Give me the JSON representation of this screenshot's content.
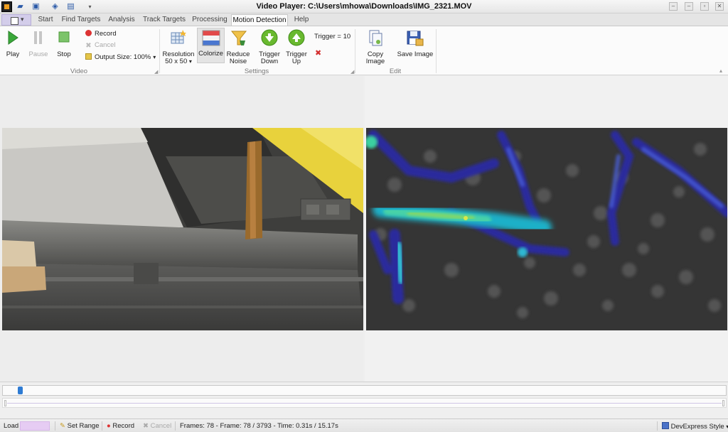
{
  "window": {
    "title": "Video Player: C:\\Users\\mhowa\\Downloads\\IMG_2321.MOV",
    "controls": [
      "–",
      "▫",
      "✕"
    ]
  },
  "tabs": [
    {
      "label": "Start"
    },
    {
      "label": "Find Targets"
    },
    {
      "label": "Analysis"
    },
    {
      "label": "Track Targets"
    },
    {
      "label": "Processing"
    },
    {
      "label": "Motion Detection",
      "active": true
    },
    {
      "label": "Help"
    }
  ],
  "ribbon": {
    "video": {
      "label": "Video",
      "play": "Play",
      "pause": "Pause",
      "stop": "Stop",
      "record": "Record",
      "cancel": "Cancel",
      "output_size": "Output Size: 100%"
    },
    "settings": {
      "label": "Settings",
      "resolution_line1": "Resolution",
      "resolution_line2": "50 x 50",
      "colorize": "Colorize",
      "reduce_noise_line1": "Reduce",
      "reduce_noise_line2": "Noise",
      "trigger_down_line1": "Trigger",
      "trigger_down_line2": "Down",
      "trigger_up_line1": "Trigger",
      "trigger_up_line2": "Up",
      "trigger_value": "Trigger = 10"
    },
    "edit": {
      "label": "Edit",
      "copy_image": "Copy Image",
      "save_image": "Save Image"
    }
  },
  "timeline": {
    "position_fraction": 0.0206
  },
  "statusbar": {
    "load": "Load",
    "set_range": "Set Range",
    "record": "Record",
    "cancel": "Cancel",
    "frame_info": "Frames: 78 - Frame: 78 / 3793 - Time: 0.31s / 15.17s",
    "style": "DevExpress Style"
  },
  "colors": {
    "accent": "#2e7bd3",
    "tab_active_bg": "#fbfbfb",
    "load_progress": "#e6ccf3"
  }
}
